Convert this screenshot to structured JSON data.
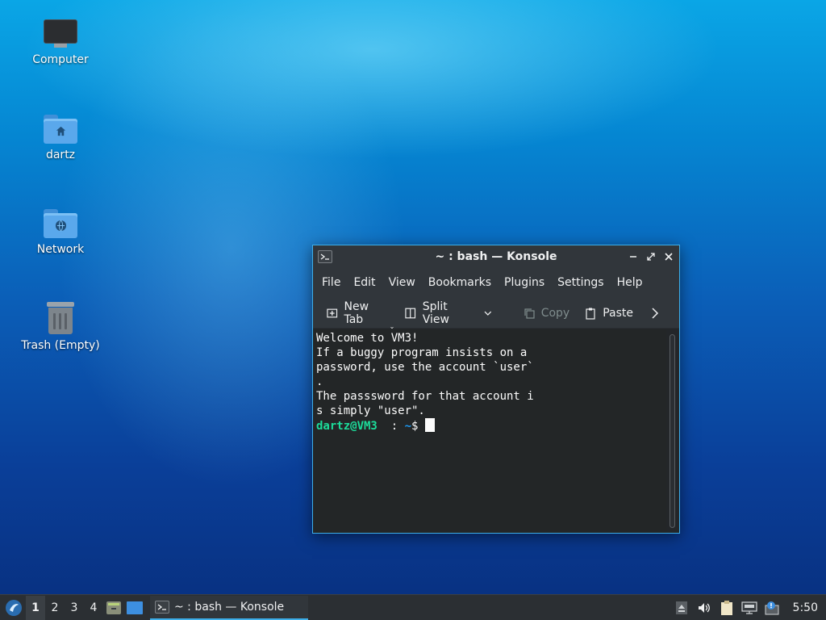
{
  "desktop": {
    "icons": [
      {
        "label": "Computer"
      },
      {
        "label": "dartz"
      },
      {
        "label": "Network"
      },
      {
        "label": "Trash (Empty)"
      }
    ]
  },
  "window": {
    "title": "~ : bash — Konsole",
    "menu": [
      "File",
      "Edit",
      "View",
      "Bookmarks",
      "Plugins",
      "Settings",
      "Help"
    ],
    "toolbar": {
      "new_tab": "New Tab",
      "split_view": "Split View",
      "copy": "Copy",
      "paste": "Paste"
    },
    "terminal": {
      "lines": [
        "Welcome to VM3!",
        "If a buggy program insists on a",
        "password, use the account `user`",
        ".",
        "The passsword for that account i",
        "s simply \"user\".",
        ""
      ],
      "prompt_user": "dartz@VM3",
      "prompt_sep": "  : ",
      "prompt_path": "~",
      "prompt_end": "$ "
    }
  },
  "taskbar": {
    "desktops": [
      "1",
      "2",
      "3",
      "4"
    ],
    "active_desktop": "1",
    "task_label": "~ : bash — Konsole",
    "clock": "5:50"
  },
  "colors": {
    "accent": "#3daee9",
    "prompt_user": "#1cdc9a",
    "prompt_path": "#1d99f3",
    "terminal_bg": "#232627"
  },
  "icons": [
    "computer-icon",
    "home-folder-icon",
    "network-folder-icon",
    "trash-icon",
    "konsole-icon",
    "minimize-icon",
    "maximize-icon",
    "close-icon",
    "new-tab-icon",
    "split-view-icon",
    "copy-icon",
    "paste-icon",
    "chevron-right-icon",
    "start-menu-icon",
    "file-manager-icon",
    "show-desktop-icon",
    "eject-icon",
    "volume-icon",
    "clipboard-icon",
    "network-icon",
    "notification-icon"
  ]
}
